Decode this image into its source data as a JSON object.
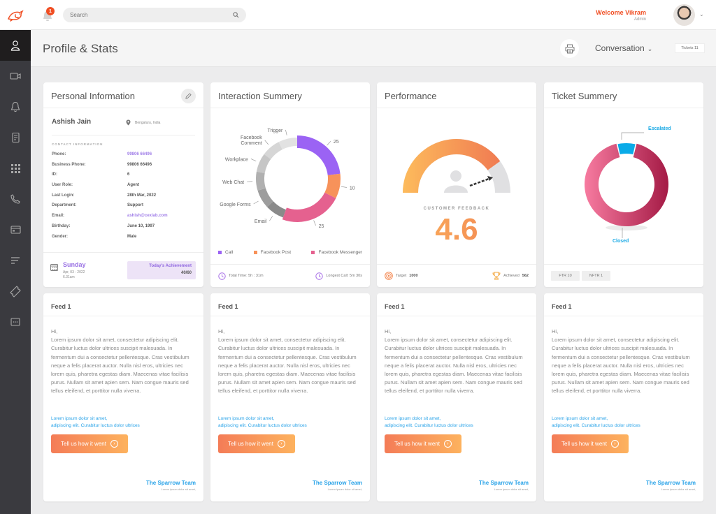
{
  "topbar": {
    "notification_count": "1",
    "search_placeholder": "Search",
    "welcome": "Welcome Vikram",
    "role": "Admin"
  },
  "sidebar": {
    "items": [
      {
        "icon": "user-icon",
        "active": true
      },
      {
        "icon": "video-icon"
      },
      {
        "icon": "bell-icon"
      },
      {
        "icon": "document-icon"
      },
      {
        "icon": "grid-icon"
      },
      {
        "icon": "phone-icon"
      },
      {
        "icon": "card-icon"
      },
      {
        "icon": "list-icon"
      },
      {
        "icon": "ticket-icon"
      },
      {
        "icon": "chat-icon"
      }
    ]
  },
  "subheader": {
    "title": "Profile & Stats",
    "dropdown": "Conversation",
    "tickets_button": "Tickets 11"
  },
  "personal_info": {
    "title": "Personal Information",
    "name": "Ashish Jain",
    "location": "Bengaluru, India",
    "section": "CONTACT INFORMATION",
    "rows": [
      {
        "label": "Phone:",
        "value": "99806 66496",
        "link": true
      },
      {
        "label": "Business Phone:",
        "value": "99806 66496"
      },
      {
        "label": "ID:",
        "value": "6"
      },
      {
        "label": "User Role:",
        "value": "Agent"
      },
      {
        "label": "Last Login:",
        "value": "28th Mar, 2022"
      },
      {
        "label": "Department:",
        "value": "Support"
      },
      {
        "label": "Email:",
        "value": "ashish@cexlab.com",
        "link": true
      },
      {
        "label": "Birthday:",
        "value": "June 10, 1997"
      },
      {
        "label": "Gender:",
        "value": "Male"
      }
    ],
    "day": "Sunday",
    "date": "Apr, 03 - 2022",
    "time": "6.31am",
    "achievement_label": "Today's Achievement",
    "achievement_value": "40/60"
  },
  "interaction": {
    "title": "Interaction Summery",
    "legend": [
      {
        "label": "Call",
        "color": "#9b63f4"
      },
      {
        "label": "Facebook Post",
        "color": "#f7925a"
      },
      {
        "label": "Facebook Messenger",
        "color": "#e5618f"
      }
    ],
    "total_time": "Total Time: 5h : 31m",
    "longest_call": "Longest Call: 5m 30s"
  },
  "performance": {
    "title": "Performance",
    "label": "CUSTOMER FEEDBACK",
    "value": "4.6",
    "gauge_fraction": 0.8,
    "target": "Target",
    "target_value": "1000",
    "achieved": "Achieved",
    "achieved_value": "562"
  },
  "ticket": {
    "title": "Ticket Summery",
    "escalated": "Escalated",
    "closed": "Closed",
    "chips": [
      "FTR 10",
      "NFTR 1"
    ]
  },
  "chart_data": [
    {
      "type": "pie",
      "title": "Interaction Summery",
      "categories": [
        "Call",
        "Facebook Post",
        "Facebook Messenger",
        "Email",
        "Google Forms",
        "Web Chat",
        "Workplace",
        "Facebook Comment",
        "Trigger"
      ],
      "values": [
        25,
        10,
        25,
        8,
        8,
        8,
        8,
        8,
        8
      ],
      "data_labels": [
        "25",
        "10",
        "25",
        "",
        "",
        "",
        "",
        "",
        ""
      ],
      "colors": [
        "#9b63f4",
        "#f7925a",
        "#e5618f",
        "#8a8a8a",
        "#9d9d9d",
        "#b0b0b0",
        "#c6c6c6",
        "#d6d6d6",
        "#e2e2e2"
      ]
    },
    {
      "type": "pie",
      "title": "Ticket Summery",
      "categories": [
        "Escalated",
        "Closed"
      ],
      "values": [
        1,
        10
      ],
      "colors": [
        "#0aabe8",
        "#c93a66"
      ]
    }
  ],
  "feeds": [
    {
      "title": "Feed 1",
      "greeting": "Hi,",
      "body": "Lorem ipsum dolor sit amet, consectetur adipiscing elit. Curabitur luctus dolor ultrices suscipit malesuada. In fermentum dui a consectetur pellentesque. Cras vestibulum neque a felis placerat auctor. Nulla nisl eros, ultricies nec lorem quis, pharetra egestas diam. Maecenas vitae facilisis purus. Nullam sit amet apien sem. Nam congue mauris sed tellus eleifend, et porttitor nulla viverra.",
      "link1": "Lorem ipsum dolor sit amet,",
      "link2": "adipiscing elit. Curabitur luctus dolor ultrices",
      "button": "Tell us how it went",
      "team": "The Sparrow Team",
      "tagline": "Lorem ipsum dolor sit amet,"
    },
    {
      "title": "Feed 1",
      "greeting": "Hi,",
      "body": "Lorem ipsum dolor sit amet, consectetur adipiscing elit. Curabitur luctus dolor ultrices suscipit malesuada. In fermentum dui a consectetur pellentesque. Cras vestibulum neque a felis placerat auctor. Nulla nisl eros, ultricies nec lorem quis, pharetra egestas diam. Maecenas vitae facilisis purus. Nullam sit amet apien sem. Nam congue mauris sed tellus eleifend, et porttitor nulla viverra.",
      "link1": "Lorem ipsum dolor sit amet,",
      "link2": "adipiscing elit. Curabitur luctus dolor ultrices",
      "button": "Tell us how it went",
      "team": "The Sparrow Team",
      "tagline": "Lorem ipsum dolor sit amet,"
    },
    {
      "title": "Feed 1",
      "greeting": "Hi,",
      "body": "Lorem ipsum dolor sit amet, consectetur adipiscing elit. Curabitur luctus dolor ultrices suscipit malesuada. In fermentum dui a consectetur pellentesque. Cras vestibulum neque a felis placerat auctor. Nulla nisl eros, ultricies nec lorem quis, pharetra egestas diam. Maecenas vitae facilisis purus. Nullam sit amet apien sem. Nam congue mauris sed tellus eleifend, et porttitor nulla viverra.",
      "link1": "Lorem ipsum dolor sit amet,",
      "link2": "adipiscing elit. Curabitur luctus dolor ultrices",
      "button": "Tell us how it went",
      "team": "The Sparrow Team",
      "tagline": "Lorem ipsum dolor sit amet,"
    },
    {
      "title": "Feed 1",
      "greeting": "Hi,",
      "body": "Lorem ipsum dolor sit amet, consectetur adipiscing elit. Curabitur luctus dolor ultrices suscipit malesuada. In fermentum dui a consectetur pellentesque. Cras vestibulum neque a felis placerat auctor. Nulla nisl eros, ultricies nec lorem quis, pharetra egestas diam. Maecenas vitae facilisis purus. Nullam sit amet apien sem. Nam congue mauris sed tellus eleifend, et porttitor nulla viverra.",
      "link1": "Lorem ipsum dolor sit amet,",
      "link2": "adipiscing elit. Curabitur luctus dolor ultrices",
      "button": "Tell us how it went",
      "team": "The Sparrow Team",
      "tagline": "Lorem ipsum dolor sit amet,"
    }
  ]
}
